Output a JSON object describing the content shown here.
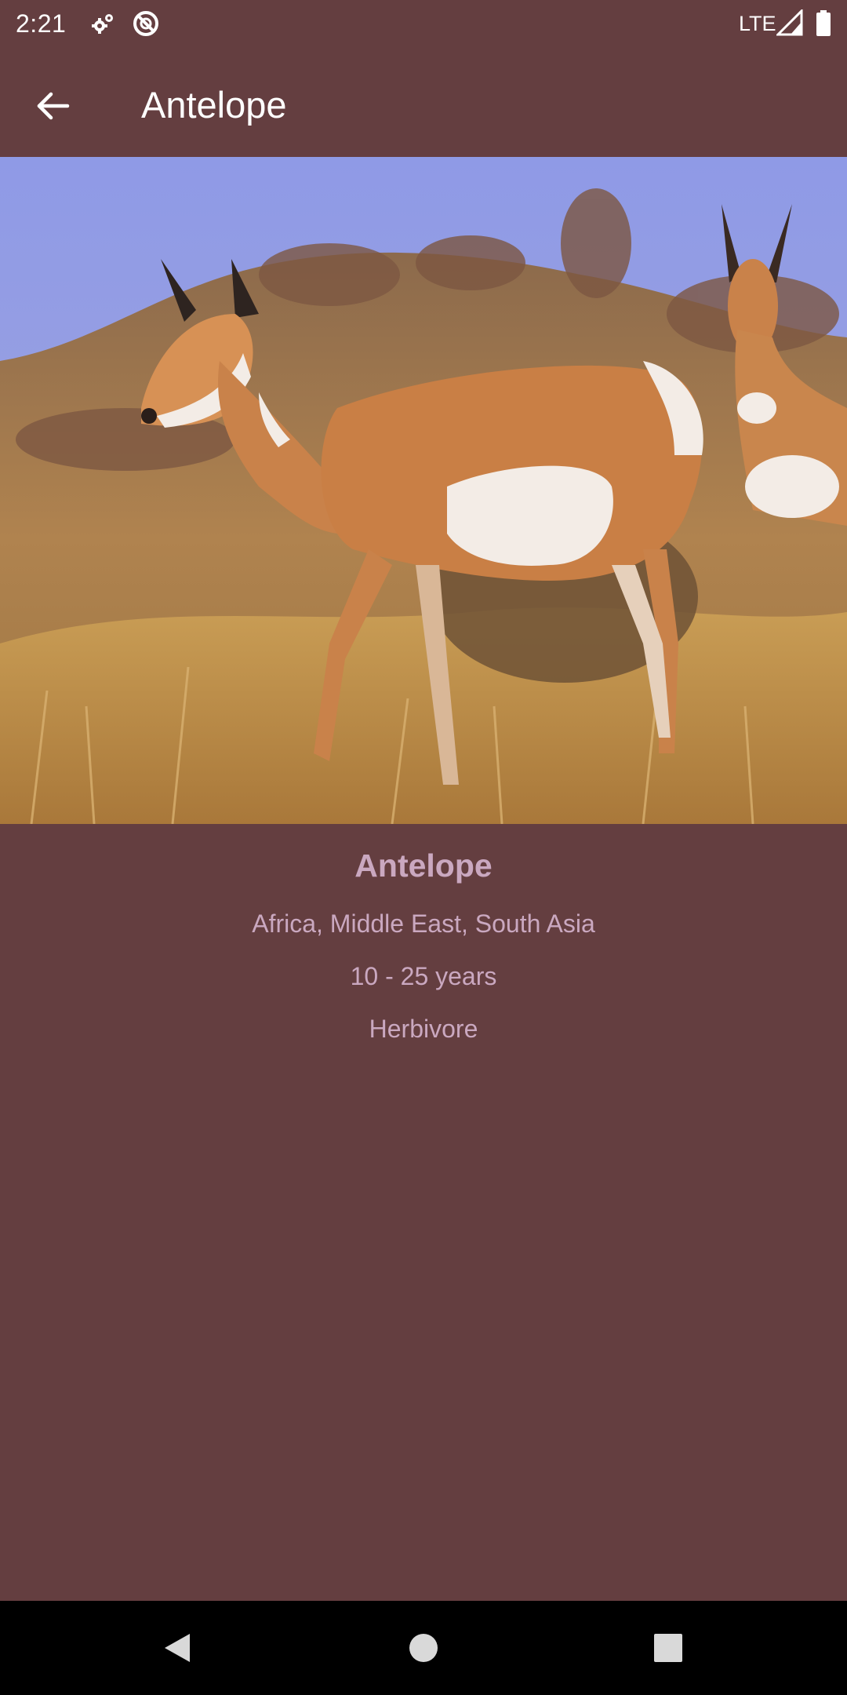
{
  "status_bar": {
    "time": "2:21",
    "network": "LTE",
    "icons": [
      "settings-sync-icon",
      "no-disturb-icon",
      "signal-icon",
      "battery-icon"
    ]
  },
  "app_bar": {
    "title": "Antelope",
    "back_icon": "arrow-back-icon"
  },
  "animal": {
    "image": "antelope-photo",
    "name": "Antelope",
    "habitat": "Africa, Middle East, South Asia",
    "lifespan": "10 - 25 years",
    "diet": "Herbivore"
  },
  "nav_bar": {
    "icons": [
      "back-triangle-icon",
      "home-circle-icon",
      "recents-square-icon"
    ]
  },
  "colors": {
    "background": "#643e40",
    "detail_text": "#caa8c0",
    "nav_bar": "#000000"
  }
}
